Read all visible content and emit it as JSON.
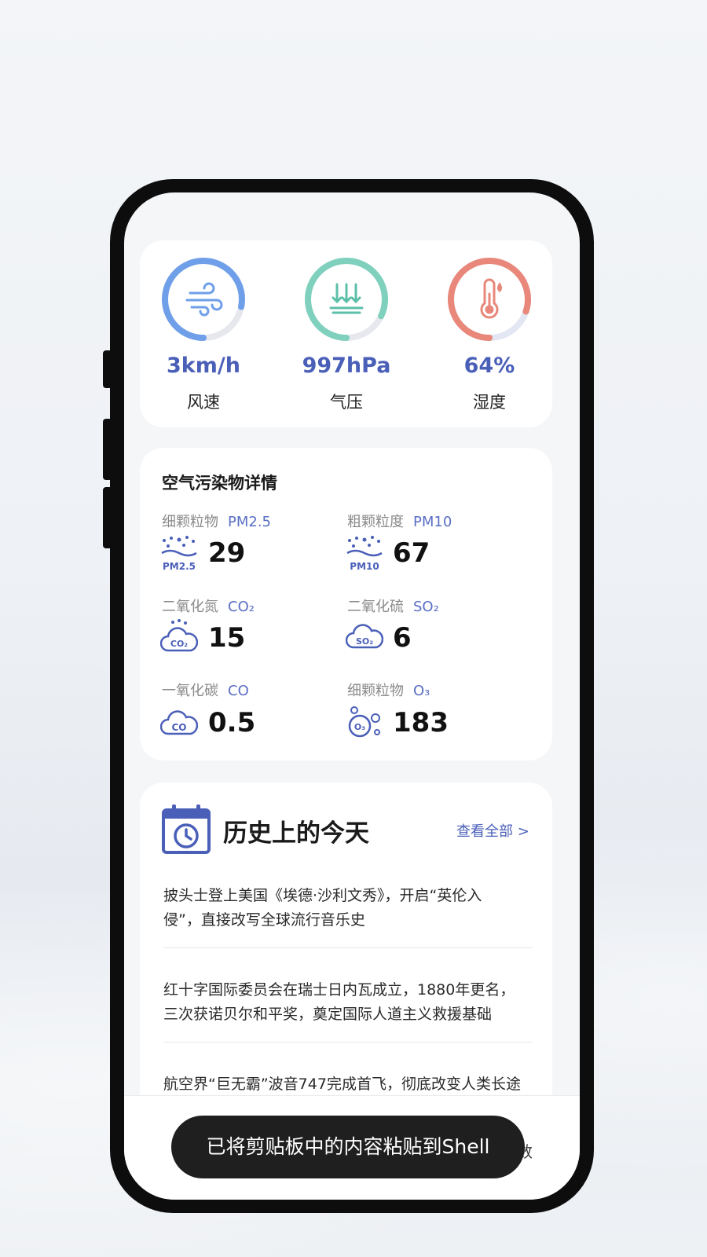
{
  "metrics": [
    {
      "value": "3km/h",
      "label": "风速",
      "icon": "wind-icon",
      "color": "#6f9fe8",
      "level": 0.78
    },
    {
      "value": "997hPa",
      "label": "气压",
      "icon": "pressure-icon",
      "color": "#7fd0bd",
      "level": 0.82
    },
    {
      "value": "64%",
      "label": "湿度",
      "icon": "thermometer-icon",
      "color": "#e8877a",
      "level": 0.8
    }
  ],
  "pollutants": {
    "title": "空气污染物详情",
    "items": [
      {
        "name": "细颗粒物",
        "code": "PM2.5",
        "value": "29",
        "icon": "pm25-icon",
        "icon_text": "PM2.5"
      },
      {
        "name": "粗颗粒度",
        "code": "PM10",
        "value": "67",
        "icon": "pm10-icon",
        "icon_text": "PM10"
      },
      {
        "name": "二氧化氮",
        "code": "CO₂",
        "value": "15",
        "icon": "co2-icon",
        "icon_text": "CO₂"
      },
      {
        "name": "二氧化硫",
        "code": "SO₂",
        "value": "6",
        "icon": "so2-icon",
        "icon_text": "SO₂"
      },
      {
        "name": "一氧化碳",
        "code": "CO",
        "value": "0.5",
        "icon": "co-icon",
        "icon_text": "CO"
      },
      {
        "name": "细颗粒物",
        "code": "O₃",
        "value": "183",
        "icon": "o3-icon",
        "icon_text": "O₃"
      }
    ]
  },
  "history": {
    "title": "历史上的今天",
    "view_all": "查看全部 >",
    "items": [
      {
        "line1": "披头士登上美国《埃德·沙利文秀》，开启“英伦入",
        "line2": "侵”，直接改写全球流行音乐史"
      },
      {
        "line1": "红十字国际委员会在瑞士日内瓦成立，1880年更名，",
        "line2": "三次获诺贝尔和平奖，奠定国际人道主义救援基础"
      },
      {
        "line1": "航空界“巨无霸”波音747完成首飞，彻底改变人类长途",
        "line2": ""
      }
    ]
  },
  "toast": "已将剪贴板中的内容粘贴到Shell",
  "bottom_tab_fragment": "指数",
  "colors": {
    "accent": "#4a5fb8",
    "card": "#ffffff",
    "screen_bg": "#f5f6f8"
  }
}
